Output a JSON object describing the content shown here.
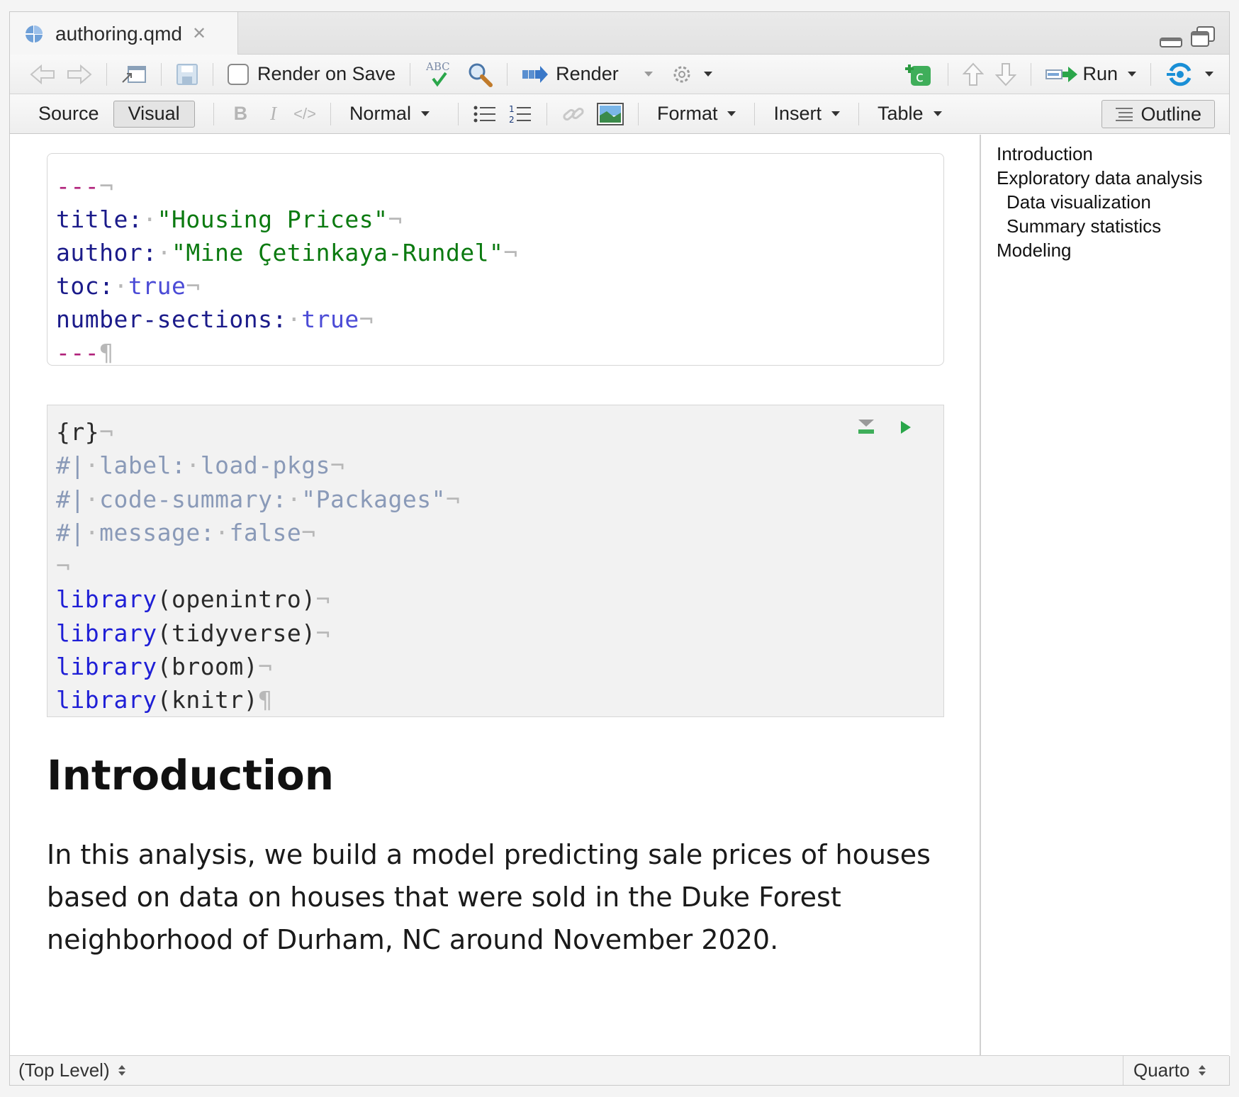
{
  "tab": {
    "filename": "authoring.qmd"
  },
  "toolbar1": {
    "render_on_save_label": "Render on Save",
    "spellcheck_text": "ABC",
    "render_label": "Render",
    "run_label": "Run"
  },
  "toolbar2": {
    "source_label": "Source",
    "visual_label": "Visual",
    "bold_label": "B",
    "italic_label": "I",
    "code_label": "</>",
    "style_select": "Normal",
    "format_label": "Format",
    "insert_label": "Insert",
    "table_label": "Table",
    "outline_label": "Outline"
  },
  "yaml": {
    "open_dashes": "---",
    "close_dashes": "---",
    "title_key": "title:",
    "title_value": "\"Housing Prices\"",
    "author_key": "author:",
    "author_value": "\"Mine Çetinkaya-Rundel\"",
    "toc_key": "toc:",
    "toc_value": "true",
    "numsec_key": "number-sections:",
    "numsec_value": "true"
  },
  "chunk": {
    "header": "{r}",
    "option_prefix": "#|",
    "opt1_key": "label:",
    "opt1_value": "load-pkgs",
    "opt2_key": "code-summary:",
    "opt2_value": "\"Packages\"",
    "opt3_key": "message:",
    "opt3_value": "false",
    "fn": "library",
    "packages": [
      "openintro",
      "tidyverse",
      "broom",
      "knitr"
    ]
  },
  "doc": {
    "heading": "Introduction",
    "paragraph": "In this analysis, we build a model predicting sale prices of houses based on data on houses that were sold in the Duke Forest neighborhood of Durham, NC around November 2020."
  },
  "outline": [
    {
      "label": "Introduction",
      "level": 1
    },
    {
      "label": "Exploratory data analysis",
      "level": 1
    },
    {
      "label": "Data visualization",
      "level": 2
    },
    {
      "label": "Summary statistics",
      "level": 2
    },
    {
      "label": "Modeling",
      "level": 1
    }
  ],
  "status": {
    "scope": "(Top Level)",
    "doc_type": "Quarto"
  },
  "colors": {
    "accent_blue": "#1a8fd6",
    "run_green": "#2aa64a",
    "yaml_key": "#1b1b8a",
    "yaml_string": "#0b7a10"
  },
  "whitespace_marks": {
    "eol": "¬",
    "pilcrow": "¶",
    "space": "·"
  }
}
